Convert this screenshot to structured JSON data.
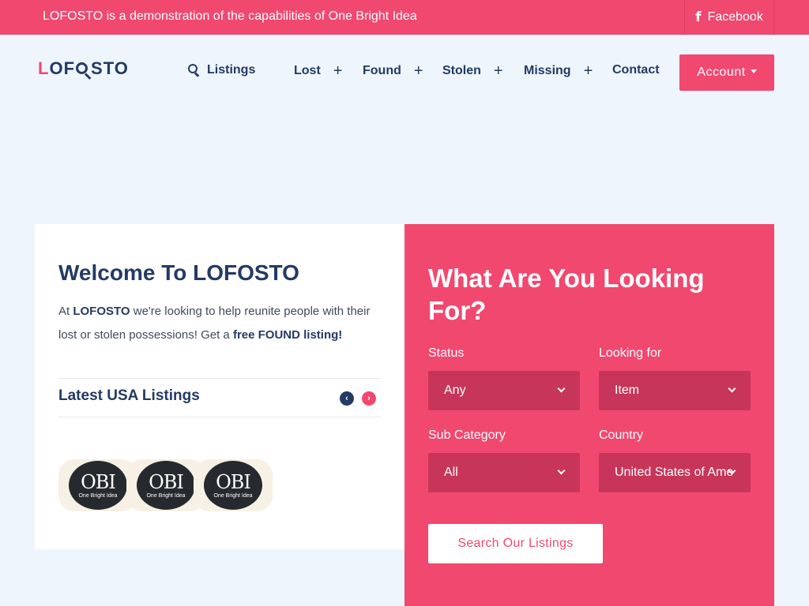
{
  "topbar": {
    "notice": "LOFOSTO is a demonstration of the capabilities of One Bright Idea",
    "facebook_label": "Facebook"
  },
  "brand": {
    "logo_l": "L",
    "logo_o": "O",
    "logo_f": "F",
    "logo_sto": "STO"
  },
  "nav": {
    "listings": "Listings",
    "lost": "Lost",
    "found": "Found",
    "stolen": "Stolen",
    "missing": "Missing",
    "contact": "Contact",
    "account": "Account",
    "plus": "+"
  },
  "welcome": {
    "title": "Welcome To LOFOSTO",
    "intro_prefix": "At ",
    "intro_brand": "LOFOSTO",
    "intro_middle": " we're looking to help reunite people with their lost or stolen possessions! Get a ",
    "intro_link": "free FOUND listing!",
    "latest_title": "Latest USA Listings",
    "prev_arrow": "‹",
    "next_arrow": "›"
  },
  "listings": [
    {
      "logo_text": "OBI",
      "logo_sub": "One Bright Idea"
    },
    {
      "logo_text": "OBI",
      "logo_sub": "One Bright Idea"
    },
    {
      "logo_text": "OBI",
      "logo_sub": "One Bright Idea"
    }
  ],
  "search": {
    "title": "What Are You Looking For?",
    "status_label": "Status",
    "status_value": "Any",
    "looking_label": "Looking for",
    "looking_value": "Item",
    "subcat_label": "Sub Category",
    "subcat_value": "All",
    "country_label": "Country",
    "country_value": "United States of America",
    "button": "Search Our Listings"
  },
  "colors": {
    "accent": "#f14870",
    "navy": "#233a64",
    "select_bg": "#c7365a",
    "page_bg": "#eef5fc"
  }
}
